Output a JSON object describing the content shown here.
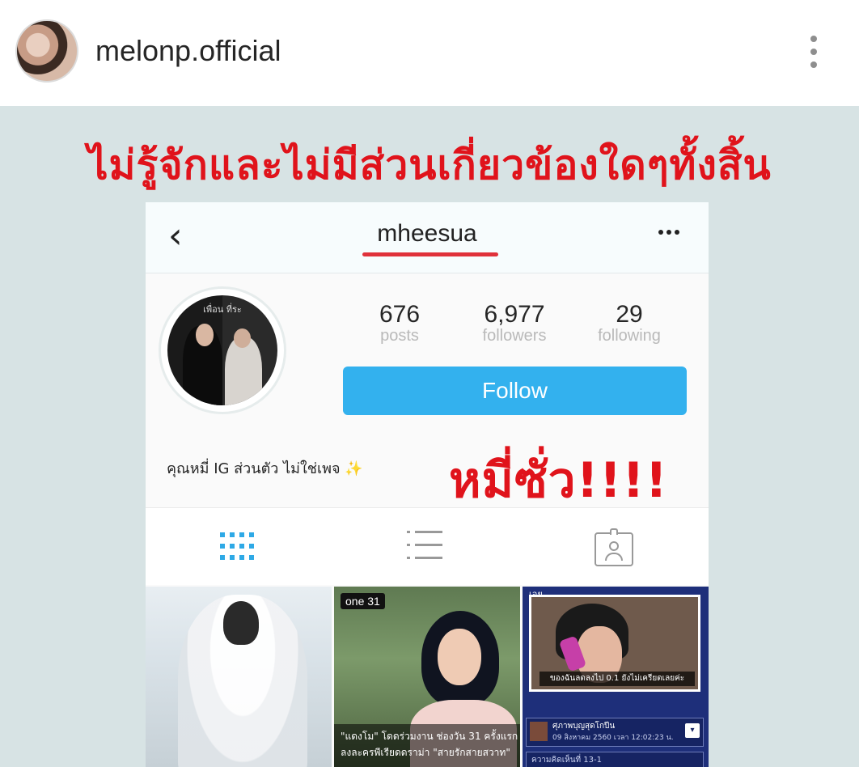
{
  "post": {
    "username": "melonp.official",
    "more_icon": "more-vertical-icon"
  },
  "image": {
    "headline": "ไม่รู้จักและไม่มีส่วนเกี่ยวข้องใดๆทั้งสิ้น",
    "overlay_text": "หมี่ซั่ว!!!!",
    "screenshot": {
      "title": "mheesua",
      "back_icon": "chevron-left-icon",
      "more_icon": "more-horizontal-icon",
      "profile_pic_caption": "เพื่อน ที่ระ",
      "stats": [
        {
          "value": "676",
          "label": "posts"
        },
        {
          "value": "6,977",
          "label": "followers"
        },
        {
          "value": "29",
          "label": "following"
        }
      ],
      "follow_label": "Follow",
      "bio": "คุณหมี่ IG ส่วนตัว ไม่ใช่เพจ",
      "bio_emoji": "✨",
      "tabs": [
        "grid-icon",
        "list-icon",
        "tagged-icon"
      ],
      "accent_color": "#33b1ee",
      "photos": {
        "p2_logo": "one 31",
        "p2_caption_line1": "\"แดงโม\" โดดร่วมงาน ช่องวัน 31 ครั้งแรก",
        "p2_caption_line2": "ลงละครพีเรียดดราม่า \"สายรักสายสวาท\"",
        "p3_label": "เอย",
        "p3_subtitle": "ของฉันลดลงไป 0.1 ยังไม่เครียดเลยค่ะ",
        "p3_panel_title": "ศุภาพบุญสุดโกปีน",
        "p3_panel_time": "09 สิงหาคม 2560 เวลา 12:02:23 น.",
        "p3_panel_drop": "▾",
        "p3_panel2": "ความคิดเห็นที่ 13-1"
      }
    }
  }
}
